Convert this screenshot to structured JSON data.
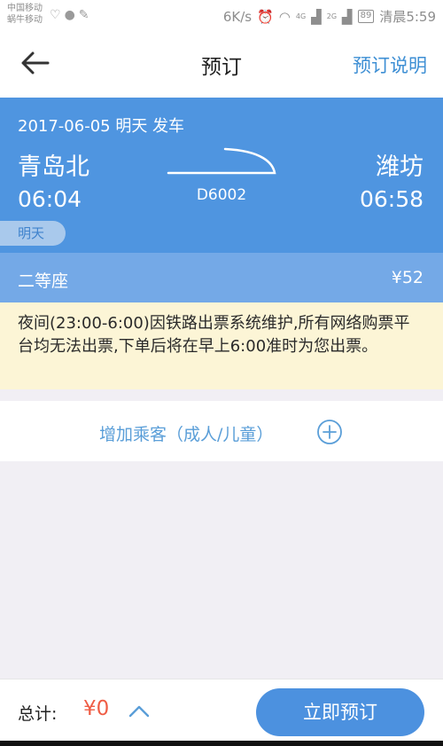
{
  "status_bar": {
    "carrier_1": "中国移动",
    "carrier_2": "蜗牛移动",
    "speed": "6K/s",
    "network_1": "4G",
    "network_2": "2G",
    "battery": "89",
    "time": "清晨5:59"
  },
  "header": {
    "title": "预订",
    "help_link": "预订说明"
  },
  "train": {
    "date_line": "2017-06-05 明天 发车",
    "from_station": "青岛北",
    "to_station": "潍坊",
    "train_no": "D6002",
    "depart_time": "06:04",
    "arrive_time": "06:58",
    "day_badge": "明天"
  },
  "seat": {
    "class": "二等座",
    "price": "¥52"
  },
  "notice": {
    "text": "夜间(23:00-6:00)因铁路出票系统维护,所有网络购票平台均无法出票,下单后将在早上6:00准时为您出票。"
  },
  "add_passenger": {
    "label": "增加乘客（成人/儿童）"
  },
  "footer": {
    "total_label": "总计:",
    "total_value": "¥0",
    "submit_label": "立即预订"
  },
  "colors": {
    "primary_blue": "#4f95e0",
    "seat_row_blue": "#74a9e7",
    "price_red": "#ef5d45",
    "notice_bg": "#fcf5d6",
    "link_blue": "#3e8fd4"
  }
}
